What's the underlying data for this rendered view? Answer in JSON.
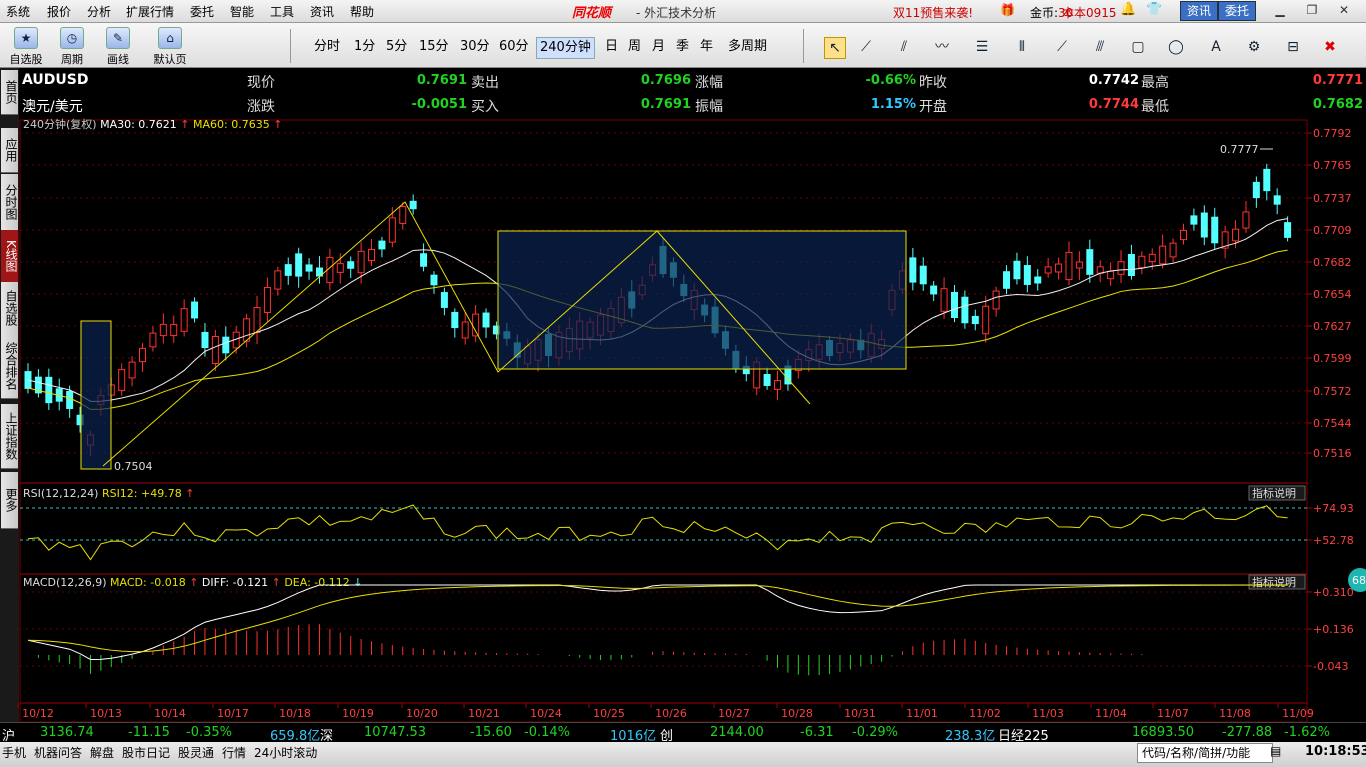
{
  "menu": {
    "items": [
      "系统",
      "报价",
      "分析",
      "扩展行情",
      "委托",
      "智能",
      "工具",
      "资讯",
      "帮助"
    ],
    "brand": "同花顺",
    "title": "- 外汇技术分析",
    "promo": "双11预售来袭!",
    "coin_label": "金币:",
    "coin_value": "30",
    "version": "本本0915",
    "btn_info": "资讯",
    "btn_trade": "委托"
  },
  "toolbar": {
    "left_buttons": [
      {
        "label": "自选股",
        "icon": "star-icon"
      },
      {
        "label": "周期",
        "icon": "cycle-icon"
      },
      {
        "label": "画线",
        "icon": "pen-icon"
      },
      {
        "label": "默认页",
        "icon": "home-icon"
      }
    ],
    "periods": [
      "分时",
      "1分",
      "5分",
      "15分",
      "30分",
      "60分",
      "240分钟",
      "日",
      "周",
      "月",
      "季",
      "年",
      "多周期"
    ],
    "selected_period": "240分钟"
  },
  "side_tabs": [
    "首页",
    "应用",
    "分时图",
    "K线图",
    "自选股",
    "综合排名",
    "上证指数",
    "更多"
  ],
  "quote": {
    "symbol": "AUDUSD",
    "name": "澳元/美元",
    "rows": [
      [
        {
          "label": "现价",
          "value": "0.7691",
          "color": "#21d321"
        },
        {
          "label": "卖出",
          "value": "0.7696",
          "color": "#21d321"
        },
        {
          "label": "涨幅",
          "value": "-0.66%",
          "color": "#21d321"
        },
        {
          "label": "昨收",
          "value": "0.7742",
          "color": "#ffffff"
        },
        {
          "label": "最高",
          "value": "0.7771",
          "color": "#ff3b3b"
        }
      ],
      [
        {
          "label": "涨跌",
          "value": "-0.0051",
          "color": "#21d321"
        },
        {
          "label": "买入",
          "value": "0.7691",
          "color": "#21d321"
        },
        {
          "label": "振幅",
          "value": "1.15%",
          "color": "#32c8ff"
        },
        {
          "label": "开盘",
          "value": "0.7744",
          "color": "#ff3b3b"
        },
        {
          "label": "最低",
          "value": "0.7682",
          "color": "#21d321"
        }
      ]
    ]
  },
  "kline": {
    "title": "240分钟(复权)",
    "ma30_label": "MA30:",
    "ma30_value": "0.7621",
    "ma60_label": "MA60:",
    "ma60_value": "0.7635",
    "y_ticks": [
      "0.7792",
      "0.7765",
      "0.7737",
      "0.7709",
      "0.7682",
      "0.7654",
      "0.7627",
      "0.7599",
      "0.7572",
      "0.7544",
      "0.7516"
    ],
    "high_label": "0.7777",
    "low_label": "0.7504"
  },
  "rsi": {
    "label": "RSI(12,12,24)",
    "rsi12_label": "RSI12:",
    "rsi12_value": "+49.78",
    "y_ticks": [
      "+74.93",
      "+52.78"
    ],
    "explain": "指标说明"
  },
  "macd": {
    "label": "MACD(12,26,9)",
    "macd_label": "MACD:",
    "macd_value": "-0.018",
    "diff_label": "DIFF:",
    "diff_value": "-0.121",
    "dea_label": "DEA:",
    "dea_value": "-0.112",
    "y_ticks": [
      "+0.310",
      "+0.136",
      "-0.043"
    ],
    "explain": "指标说明",
    "badge": "68"
  },
  "x_dates": [
    "10/12",
    "10/13",
    "10/14",
    "10/17",
    "10/18",
    "10/19",
    "10/20",
    "10/21",
    "10/24",
    "10/25",
    "10/26",
    "10/27",
    "10/28",
    "10/31",
    "11/01",
    "11/02",
    "11/03",
    "11/04",
    "11/07",
    "11/08",
    "11/09"
  ],
  "index_bar": [
    {
      "text": "沪",
      "color": "#ffffff"
    },
    {
      "text": "3136.74",
      "color": "#21d321"
    },
    {
      "text": "-11.15",
      "color": "#21d321"
    },
    {
      "text": "-0.35%",
      "color": "#21d321"
    },
    {
      "text": "659.8亿",
      "color": "#32c8ff"
    },
    {
      "text": "深",
      "color": "#ffffff"
    },
    {
      "text": "10747.53",
      "color": "#21d321"
    },
    {
      "text": "-15.60",
      "color": "#21d321"
    },
    {
      "text": "-0.14%",
      "color": "#21d321"
    },
    {
      "text": "1016亿",
      "color": "#32c8ff"
    },
    {
      "text": "创",
      "color": "#ffffff"
    },
    {
      "text": "2144.00",
      "color": "#21d321"
    },
    {
      "text": "-6.31",
      "color": "#21d321"
    },
    {
      "text": "-0.29%",
      "color": "#21d321"
    },
    {
      "text": "238.3亿",
      "color": "#32c8ff"
    },
    {
      "text": "日经225",
      "color": "#ffffff"
    },
    {
      "text": "16893.50",
      "color": "#21d321"
    },
    {
      "text": "-277.88",
      "color": "#21d321"
    },
    {
      "text": "-1.62%",
      "color": "#21d321"
    }
  ],
  "taskbar": {
    "items": [
      "手机",
      "机器问答",
      "解盘",
      "股市日记",
      "股灵通",
      "行情",
      "24小时滚动"
    ],
    "search_placeholder": "代码/名称/简拼/功能",
    "clock": "10:18:53"
  }
}
